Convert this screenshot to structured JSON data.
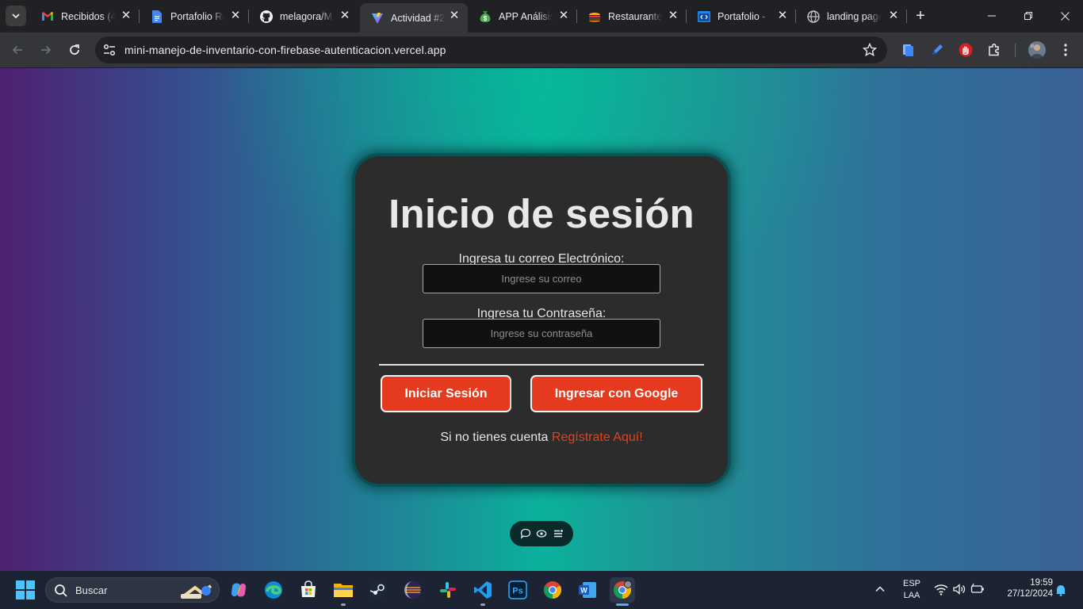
{
  "browser": {
    "tabs": [
      {
        "title": "Recibidos (4",
        "favicon": "gmail-icon"
      },
      {
        "title": "Portafolio Re",
        "favicon": "docs-icon"
      },
      {
        "title": "melagora/M",
        "favicon": "github-icon"
      },
      {
        "title": "Actividad #2",
        "favicon": "vite-icon"
      },
      {
        "title": "APP Análisis",
        "favicon": "money-bag-icon"
      },
      {
        "title": "Restaurante",
        "favicon": "burger-icon"
      },
      {
        "title": "Portafolio -",
        "favicon": "code-window-icon"
      },
      {
        "title": "landing page",
        "favicon": "globe-icon"
      }
    ],
    "active_tab_index": 3,
    "url": "mini-manejo-de-inventario-con-firebase-autenticacion.vercel.app"
  },
  "login": {
    "title": "Inicio de sesión",
    "email_label": "Ingresa tu correo Electrónico:",
    "email_placeholder": "Ingrese su correo",
    "password_label": "Ingresa tu Contraseña:",
    "password_placeholder": "Ingrese su contraseña",
    "signin_button": "Iniciar Sesión",
    "google_button": "Ingresar con Google",
    "register_prompt": "Si no tienes cuenta",
    "register_link": "Regístrate Aquí!"
  },
  "taskbar": {
    "search_label": "Buscar",
    "language": "ESP",
    "language_sub": "LAA",
    "time": "19:59",
    "date": "27/12/2024"
  },
  "colors": {
    "accent_button": "#e53a1e",
    "card_background": "#2c2c2c",
    "link": "#e5401f"
  }
}
